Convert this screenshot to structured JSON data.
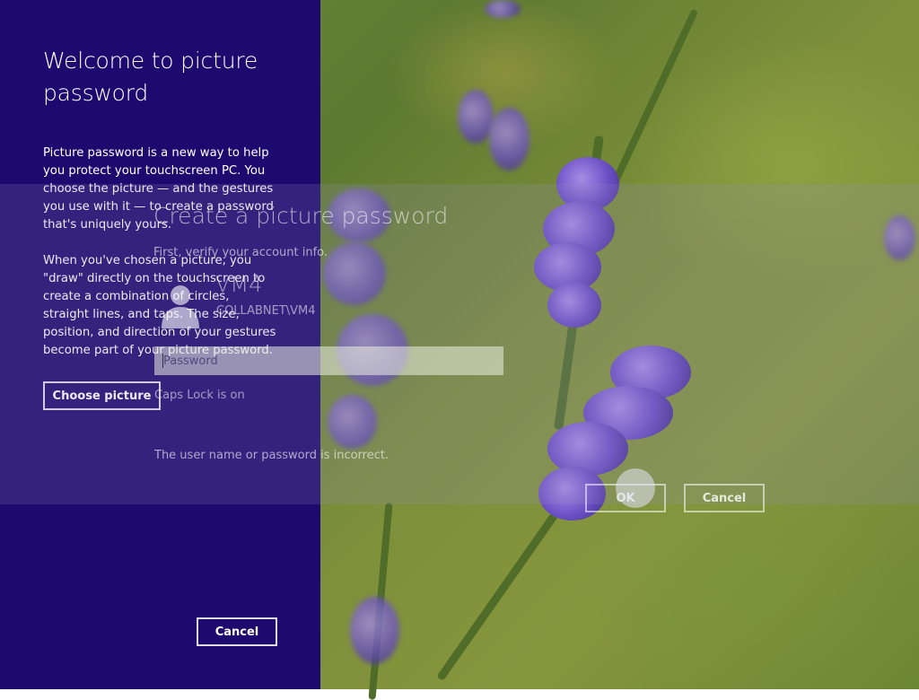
{
  "left_panel": {
    "title": "Welcome to picture password",
    "paragraph_1": "Picture password is a new way to help you protect your touchscreen PC. You choose the picture — and the gestures you use with it — to create a password that's uniquely yours.",
    "paragraph_2": "When you've chosen a picture, you \"draw\" directly on the touchscreen to create a combination of circles, straight lines, and taps. The size, position, and direction of your gestures become part of your picture password.",
    "choose_button": "Choose picture",
    "cancel_button": "Cancel"
  },
  "dialog": {
    "title": "Create a picture password",
    "subtitle": "First, verify your account info.",
    "user_name": "VM4",
    "user_domain": "COLLABNET\\VM4",
    "password_placeholder": "Password",
    "caps_lock_message": "Caps Lock is on",
    "error_message": "The user name or password is incorrect.",
    "ok_button": "OK",
    "cancel_button": "Cancel"
  },
  "colors": {
    "panel_background": "#1c0a6e",
    "accent": "#6a4fc4"
  },
  "icons": {
    "user": "user-silhouette-icon"
  }
}
